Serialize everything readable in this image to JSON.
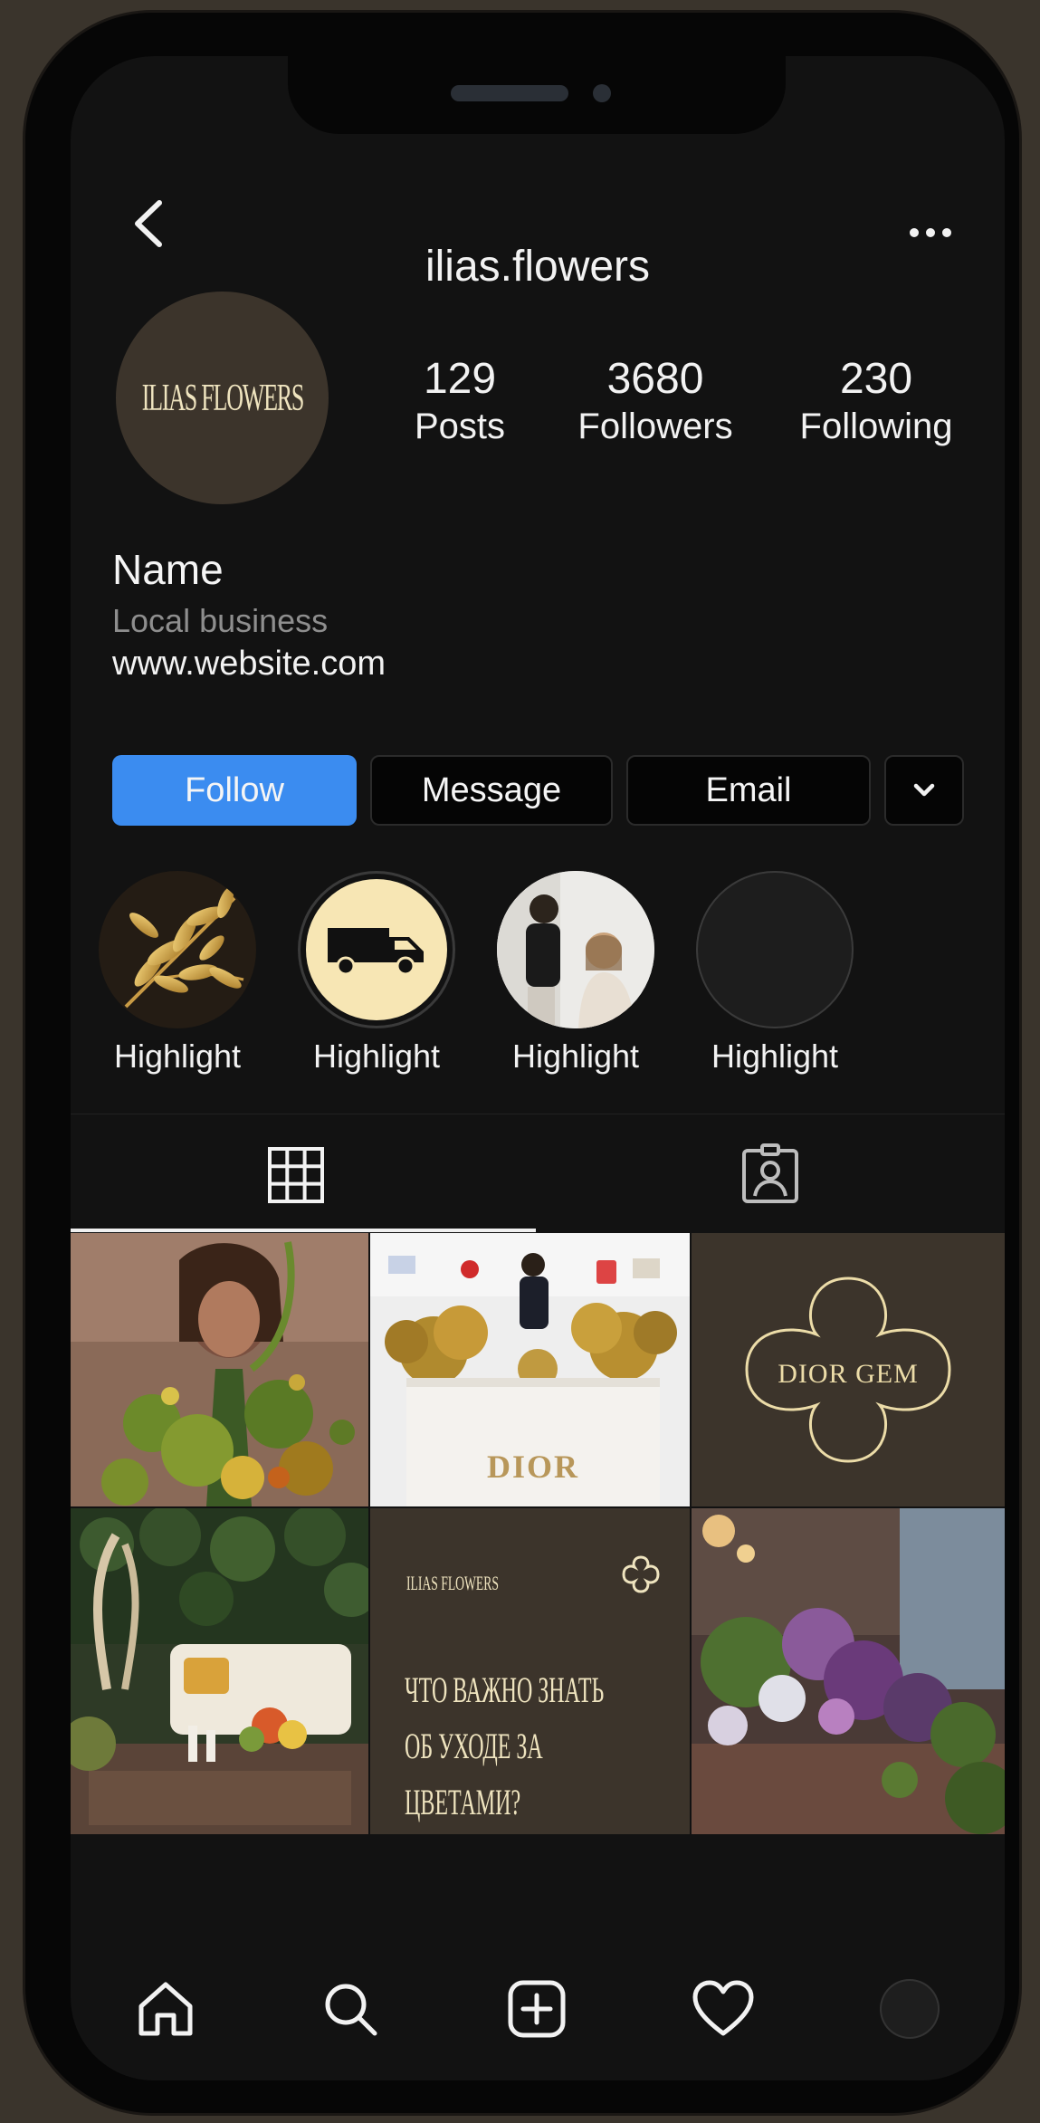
{
  "header": {
    "username": "ilias.flowers"
  },
  "profile": {
    "avatar_text": "ILIAS   FLOWERS",
    "stats": [
      {
        "value": "129",
        "label": "Posts"
      },
      {
        "value": "3680",
        "label": "Followers"
      },
      {
        "value": "230",
        "label": "Following"
      }
    ],
    "name": "Name",
    "category": "Local business",
    "website": "www.website.com"
  },
  "actions": {
    "follow_label": "Follow",
    "message_label": "Message",
    "email_label": "Email"
  },
  "highlights": [
    {
      "label": "Highlight"
    },
    {
      "label": "Highlight"
    },
    {
      "label": "Highlight"
    },
    {
      "label": "Highlight"
    }
  ],
  "posts": {
    "dior_label": "DIOR",
    "dior_gem_label": "DIOR GEM",
    "card_brand": "ILIAS   FLOWERS",
    "card_text_lines": [
      "ЧТО ВАЖНО ЗНАТЬ",
      "ОБ УХОДЕ ЗА",
      "ЦВЕТАМИ?"
    ]
  },
  "colors": {
    "background": "#121212",
    "accent_blue": "#3b8cf0",
    "brand_brown": "#3c342b",
    "brand_cream": "#efe4bf"
  }
}
